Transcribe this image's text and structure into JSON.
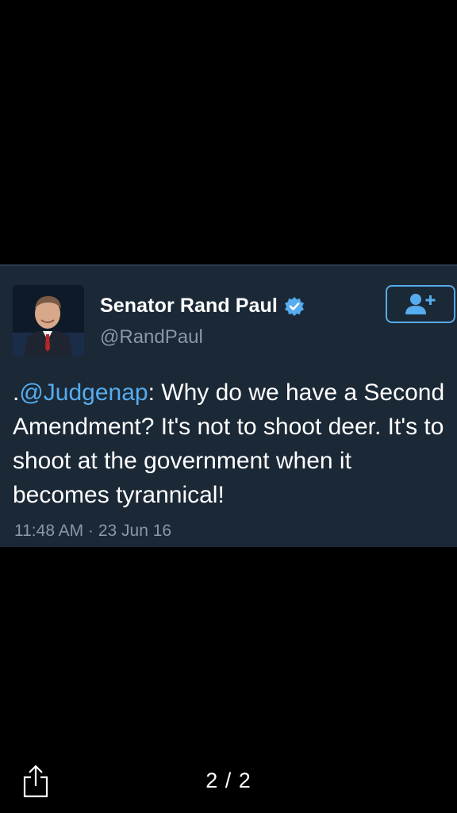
{
  "tweet": {
    "display_name": "Senator Rand Paul",
    "handle": "@RandPaul",
    "text_prefix": ".",
    "mention": "@Judgenap",
    "text_body": ": Why do we have a Second Amendment? It's not to shoot deer. It's to shoot at the government when it becomes tyrannical!",
    "timestamp": "11:48 AM · 23 Jun 16",
    "verified": true
  },
  "follow_button": {
    "icon": "add-user-icon"
  },
  "viewer": {
    "page_counter": "2 / 2",
    "share_icon": "share-icon"
  },
  "colors": {
    "background": "#000000",
    "card": "#1b2836",
    "accent": "#55acee",
    "secondary_text": "#8899a6"
  }
}
